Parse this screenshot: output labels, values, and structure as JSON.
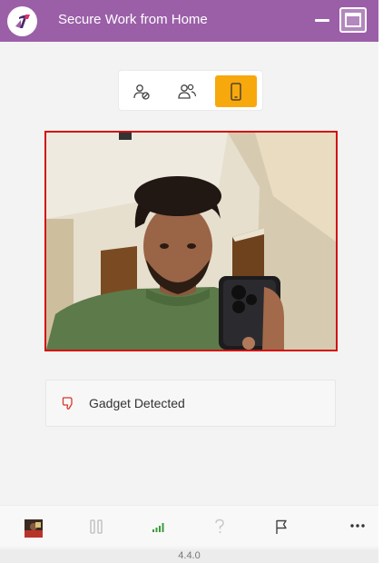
{
  "window": {
    "title": "Secure Work from Home",
    "version": "4.4.0"
  },
  "mode_switcher": {
    "items": [
      {
        "icon": "no-person-icon",
        "active": false
      },
      {
        "icon": "people-icon",
        "active": false
      },
      {
        "icon": "phone-icon",
        "active": true
      }
    ]
  },
  "camera": {
    "border_color": "#d20f0f"
  },
  "status": {
    "icon": "thumbs-down-icon",
    "message": "Gadget Detected",
    "icon_color": "#d9372c"
  },
  "bottom_bar": {
    "items": [
      "avatar",
      "pause-icon",
      "signal-icon",
      "help-icon",
      "flag-icon",
      "more-icon"
    ],
    "signal_color": "#3a9b3a"
  },
  "colors": {
    "titlebar": "#9b5fa8",
    "accent": "#f7a80c"
  }
}
